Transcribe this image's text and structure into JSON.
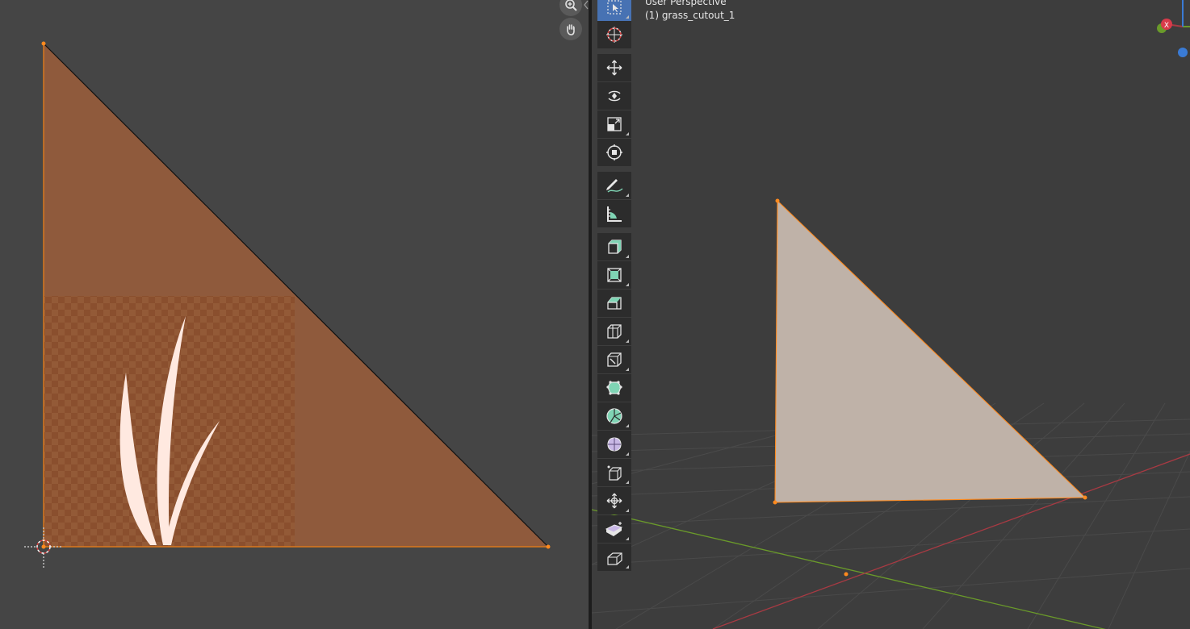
{
  "viewport": {
    "perspective_label": "User Perspective",
    "object_label": "(1) grass_cutout_1",
    "gizmo_x_label": "X"
  },
  "uv_editor": {
    "nav": [
      {
        "icon": "zoom-icon"
      },
      {
        "icon": "hand-pan-icon"
      }
    ]
  },
  "toolbar": {
    "tools": [
      {
        "name": "select-box-tool",
        "active": true
      },
      {
        "name": "cursor-tool"
      },
      {
        "name": "move-tool"
      },
      {
        "name": "rotate-tool"
      },
      {
        "name": "scale-tool"
      },
      {
        "name": "transform-tool"
      },
      {
        "name": "annotate-tool"
      },
      {
        "name": "measure-tool"
      },
      {
        "name": "add-cube-tool"
      },
      {
        "name": "extrude-region-tool"
      },
      {
        "name": "inset-faces-tool"
      },
      {
        "name": "bevel-tool"
      },
      {
        "name": "loop-cut-tool"
      },
      {
        "name": "knife-tool"
      },
      {
        "name": "poly-build-tool"
      },
      {
        "name": "spin-tool"
      },
      {
        "name": "smooth-tool"
      },
      {
        "name": "edge-slide-tool"
      },
      {
        "name": "shrink-fatten-tool"
      },
      {
        "name": "shear-tool"
      },
      {
        "name": "rip-region-tool"
      }
    ]
  },
  "colors": {
    "uv_face": "#8f5a3c",
    "texture_bg": "#8a4f2e",
    "grass": "#ffe9e0",
    "mesh_face": "#bfb2a8",
    "selection": "#ff8a1e",
    "x_axis": "#a83a43",
    "y_axis": "#6a9a2a",
    "active_tool": "#4772b3"
  }
}
